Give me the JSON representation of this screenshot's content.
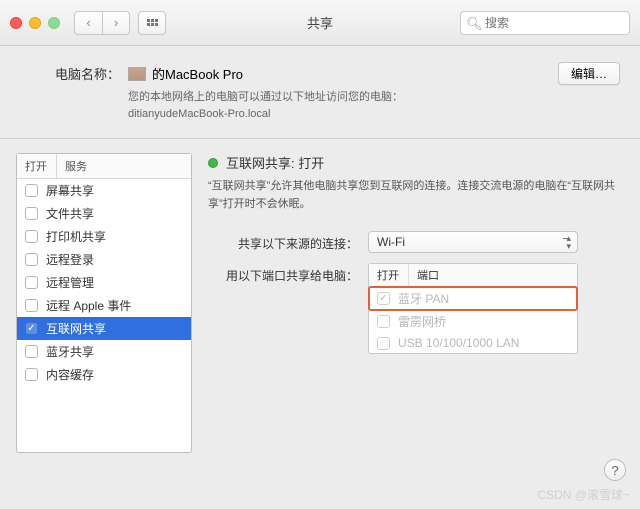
{
  "window": {
    "title": "共享"
  },
  "search": {
    "placeholder": "搜索"
  },
  "computer": {
    "label": "电脑名称：",
    "name_suffix": "的MacBook Pro",
    "desc_line1": "您的本地网络上的电脑可以通过以下地址访问您的电脑：",
    "desc_line2": "ditianyudeMacBook-Pro.local",
    "edit": "编辑…"
  },
  "sidebar": {
    "head_on": "打开",
    "head_svc": "服务",
    "items": [
      {
        "label": "屏幕共享",
        "checked": false
      },
      {
        "label": "文件共享",
        "checked": false
      },
      {
        "label": "打印机共享",
        "checked": false
      },
      {
        "label": "远程登录",
        "checked": false
      },
      {
        "label": "远程管理",
        "checked": false
      },
      {
        "label": "远程 Apple 事件",
        "checked": false
      },
      {
        "label": "互联网共享",
        "checked": true,
        "selected": true
      },
      {
        "label": "蓝牙共享",
        "checked": false
      },
      {
        "label": "内容缓存",
        "checked": false
      }
    ]
  },
  "detail": {
    "status_title": "互联网共享: 打开",
    "status_desc": "“互联网共享”允许其他电脑共享您到互联网的连接。连接交流电源的电脑在“互联网共享”打开时不会休眠。",
    "source_label": "共享以下来源的连接：",
    "source_value": "Wi-Fi",
    "ports_label": "用以下端口共享给电脑：",
    "ports_head_on": "打开",
    "ports_head_port": "端口",
    "ports": [
      {
        "label": "蓝牙 PAN",
        "checked": true,
        "highlight": true
      },
      {
        "label": "雷雳网桥",
        "checked": false
      },
      {
        "label": "USB 10/100/1000 LAN",
        "checked": false
      }
    ]
  },
  "watermark": "CSDN @滚雪球~"
}
